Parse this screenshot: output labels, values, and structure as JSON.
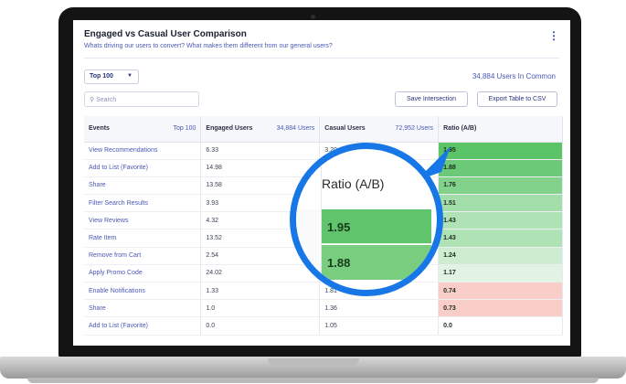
{
  "header": {
    "title": "Engaged vs Casual User Comparison",
    "subtitle": "Whats driving our users to convert? What makes them different from our general users?"
  },
  "controls": {
    "top_select": "Top 100",
    "users_in_common": "34,884 Users In Common",
    "search_placeholder": "Search",
    "save_button": "Save Intersection",
    "export_button": "Export Table to CSV"
  },
  "table": {
    "columns": [
      {
        "label": "Events",
        "sub": "Top 100"
      },
      {
        "label": "Engaged Users",
        "sub": "34,884 Users"
      },
      {
        "label": "Casual Users",
        "sub": "72,952 Users"
      },
      {
        "label": "Ratio (A/B)",
        "sub": ""
      }
    ],
    "rows": [
      {
        "event": "View Recommendations",
        "engaged": "6.33",
        "casual": "3.20",
        "ratio": "1.95",
        "color": "#5ac466"
      },
      {
        "event": "Add to List (Favorite)",
        "engaged": "14.98",
        "casual": "",
        "ratio": "1.88",
        "color": "#6cc978"
      },
      {
        "event": "Share",
        "engaged": "13.58",
        "casual": "",
        "ratio": "1.76",
        "color": "#82d28c"
      },
      {
        "event": "Filter Search Results",
        "engaged": "3.93",
        "casual": "",
        "ratio": "1.51",
        "color": "#a3ddaa"
      },
      {
        "event": "View Reviews",
        "engaged": "4.32",
        "casual": "",
        "ratio": "1.43",
        "color": "#afe2b5"
      },
      {
        "event": "Rate Item",
        "engaged": "13.52",
        "casual": "",
        "ratio": "1.43",
        "color": "#afe2b5"
      },
      {
        "event": "Remove from Cart",
        "engaged": "2.54",
        "casual": "",
        "ratio": "1.24",
        "color": "#cdecd0"
      },
      {
        "event": "Apply Promo Code",
        "engaged": "24.02",
        "casual": "",
        "ratio": "1.17",
        "color": "#e1f3e2"
      },
      {
        "event": "Enable Notifications",
        "engaged": "1.33",
        "casual": "1.81",
        "ratio": "0.74",
        "color": "#f9cdc8"
      },
      {
        "event": "Share",
        "engaged": "1.0",
        "casual": "1.36",
        "ratio": "0.73",
        "color": "#f9cdc8"
      },
      {
        "event": "Add to List (Favorite)",
        "engaged": "0.0",
        "casual": "1.05",
        "ratio": "0.0",
        "color": "#ffffff"
      }
    ]
  },
  "magnifier": {
    "heading": "Ratio (A/B)",
    "cells": [
      "1.95",
      "1.88"
    ],
    "border_color": "#1877e6"
  }
}
